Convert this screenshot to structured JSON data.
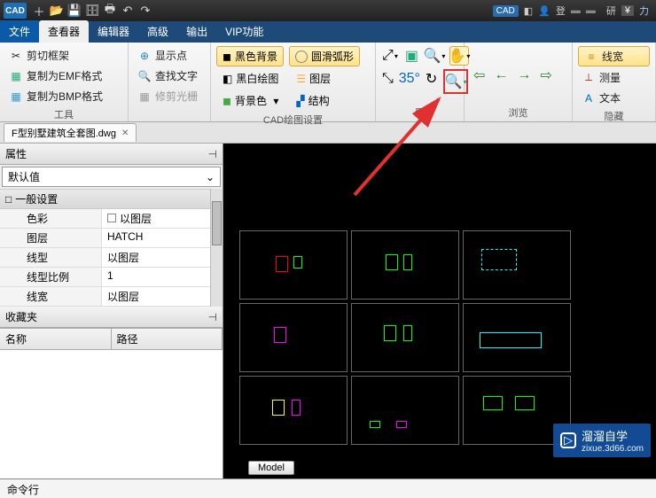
{
  "titlebar": {
    "logo": "CAD",
    "right_badge": "CAD",
    "right_user_prefix": "登",
    "right_user_suffix": "研",
    "right_yen": "¥",
    "right_tail": "力"
  },
  "menu": {
    "file": "文件",
    "viewer": "查看器",
    "editor": "编辑器",
    "advanced": "高级",
    "output": "输出",
    "vip": "VIP功能"
  },
  "ribbon": {
    "tools_group": "工具",
    "cad_settings_group": "CAD绘图设置",
    "position_group": "置",
    "browse_group": "浏览",
    "hide_group": "隐藏",
    "crop_frame": "剪切框架",
    "copy_emf": "复制为EMF格式",
    "copy_bmp": "复制为BMP格式",
    "show_point": "显示点",
    "find_text": "查找文字",
    "trim_grid": "修剪光栅",
    "black_bg": "黑色背景",
    "bw_draw": "黑白绘图",
    "bg_color": "背景色",
    "smooth_arc": "圆滑弧形",
    "layers": "图层",
    "structure": "结构",
    "line_width": "线宽",
    "measure": "测量",
    "text": "文本"
  },
  "file_tab": {
    "name": "F型别墅建筑全套图.dwg"
  },
  "panels": {
    "properties_title": "属性",
    "default_label": "默认值",
    "general_cat": "一般设置",
    "rows": [
      {
        "k": "色彩",
        "v": "以图层"
      },
      {
        "k": "图层",
        "v": "HATCH"
      },
      {
        "k": "线型",
        "v": "以图层"
      },
      {
        "k": "线型比例",
        "v": "1"
      },
      {
        "k": "线宽",
        "v": "以图层"
      }
    ],
    "favorites_title": "收藏夹",
    "fav_col_name": "名称",
    "fav_col_path": "路径"
  },
  "checkbox_label": "以图层",
  "model_tab": "Model",
  "cmd_label": "命令行",
  "watermark": {
    "brand": "溜溜自学",
    "url": "zixue.3d66.com"
  }
}
